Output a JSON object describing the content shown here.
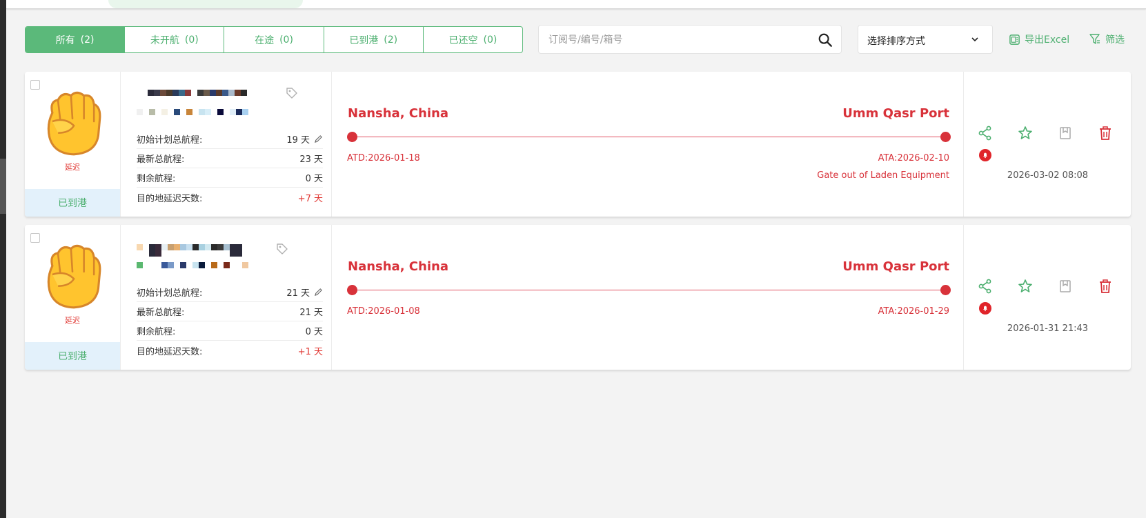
{
  "colors": {
    "accent": "#5bb97a",
    "danger": "#d8323a",
    "status_bg": "#e3f1fb"
  },
  "tabs": [
    {
      "label": "所有",
      "count": "(2)"
    },
    {
      "label": "未开航",
      "count": "(0)"
    },
    {
      "label": "在途",
      "count": "(0)"
    },
    {
      "label": "已到港",
      "count": "(2)"
    },
    {
      "label": "已还空",
      "count": "(0)"
    }
  ],
  "search": {
    "placeholder": "订阅号/编号/箱号",
    "value": "",
    "icon": "search-icon"
  },
  "sort": {
    "selected": "选择排序方式",
    "icon": "chevron-down-icon"
  },
  "toolbar": {
    "export_label": "导出Excel",
    "filter_label": "筛选"
  },
  "shipments": [
    {
      "avatar": "raised-fist-icon",
      "delay_label": "延迟",
      "status": "已到港",
      "info": [
        {
          "label": "初始计划总航程:",
          "value": "19 天",
          "editable": true
        },
        {
          "label": "最新总航程:",
          "value": "23 天"
        },
        {
          "label": "剩余航程:",
          "value": "0 天"
        },
        {
          "label": "目的地延迟天数:",
          "value": "+7 天",
          "highlight": true
        }
      ],
      "origin": "Nansha, China",
      "destination": "Umm Qasr Port",
      "atd": "ATD:2026-01-18",
      "ata": "ATA:2026-02-10",
      "event": "Gate out of Laden Equipment",
      "timestamp": "2026-03-02 08:08"
    },
    {
      "avatar": "raised-fist-icon",
      "delay_label": "延迟",
      "status": "已到港",
      "info": [
        {
          "label": "初始计划总航程:",
          "value": "21 天",
          "editable": true
        },
        {
          "label": "最新总航程:",
          "value": "21 天"
        },
        {
          "label": "剩余航程:",
          "value": "0 天"
        },
        {
          "label": "目的地延迟天数:",
          "value": "+1 天",
          "highlight": true
        }
      ],
      "origin": "Nansha, China",
      "destination": "Umm Qasr Port",
      "atd": "ATD:2026-01-08",
      "ata": "ATA:2026-01-29",
      "event": "",
      "timestamp": "2026-01-31 21:43"
    }
  ]
}
